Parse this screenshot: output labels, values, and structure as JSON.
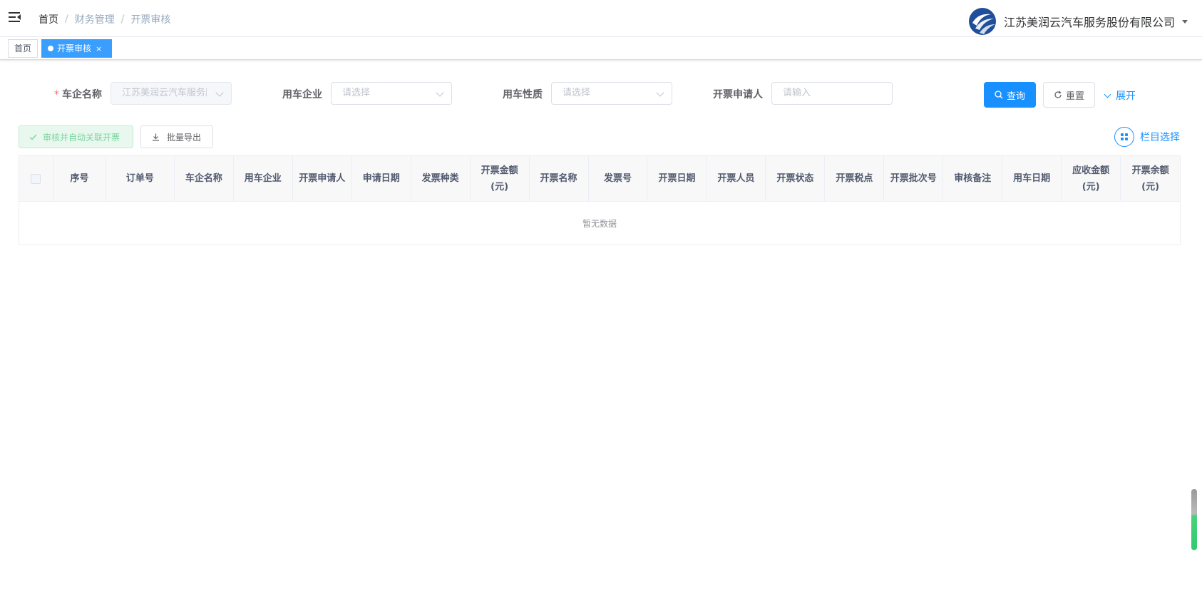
{
  "breadcrumb": {
    "home": "首页",
    "section": "财务管理",
    "page": "开票审核",
    "sep": "/"
  },
  "company": {
    "name": "江苏美润云汽车服务股份有限公司"
  },
  "tags": [
    {
      "label": "首页"
    },
    {
      "label": "开票审核",
      "close": "×"
    }
  ],
  "search": {
    "car_company": {
      "required": "*",
      "label": "车企名称",
      "value": "江苏美润云汽车服务股份有限公司"
    },
    "user_company": {
      "label": "用车企业",
      "placeholder": "请选择"
    },
    "usage_type": {
      "label": "用车性质",
      "placeholder": "请选择"
    },
    "applicant": {
      "label": "开票申请人",
      "placeholder": "请输入"
    },
    "query_label": "查询",
    "reset_label": "重置",
    "expand_label": "展开"
  },
  "toolbar": {
    "approve_label": "审核并自动关联开票",
    "export_label": "批量导出",
    "columns_label": "栏目选择"
  },
  "table": {
    "columns": [
      {
        "key": "checkbox",
        "label": ""
      },
      {
        "key": "index",
        "label": "序号"
      },
      {
        "key": "order_no",
        "label": "订单号"
      },
      {
        "key": "car_company",
        "label": "车企名称"
      },
      {
        "key": "user_company",
        "label": "用车企业"
      },
      {
        "key": "applicant",
        "label": "开票申请人"
      },
      {
        "key": "apply_date",
        "label": "申请日期"
      },
      {
        "key": "invoice_type",
        "label": "发票种类"
      },
      {
        "key": "amount",
        "label": "开票金额(元)"
      },
      {
        "key": "invoice_name",
        "label": "开票名称"
      },
      {
        "key": "invoice_no",
        "label": "发票号"
      },
      {
        "key": "invoice_date",
        "label": "开票日期"
      },
      {
        "key": "issuer",
        "label": "开票人员"
      },
      {
        "key": "status",
        "label": "开票状态"
      },
      {
        "key": "tax_point",
        "label": "开票税点"
      },
      {
        "key": "batch_no",
        "label": "开票批次号"
      },
      {
        "key": "review_note",
        "label": "审核备注"
      },
      {
        "key": "use_date",
        "label": "用车日期"
      },
      {
        "key": "receivable",
        "label": "应收金额(元)"
      },
      {
        "key": "balance",
        "label": "开票余额(元)"
      }
    ],
    "empty_text": "暂无数据"
  },
  "colors": {
    "primary": "#1890ff",
    "tag_active": "#3a9eff",
    "success_plain_bg": "#e8f8ee"
  }
}
